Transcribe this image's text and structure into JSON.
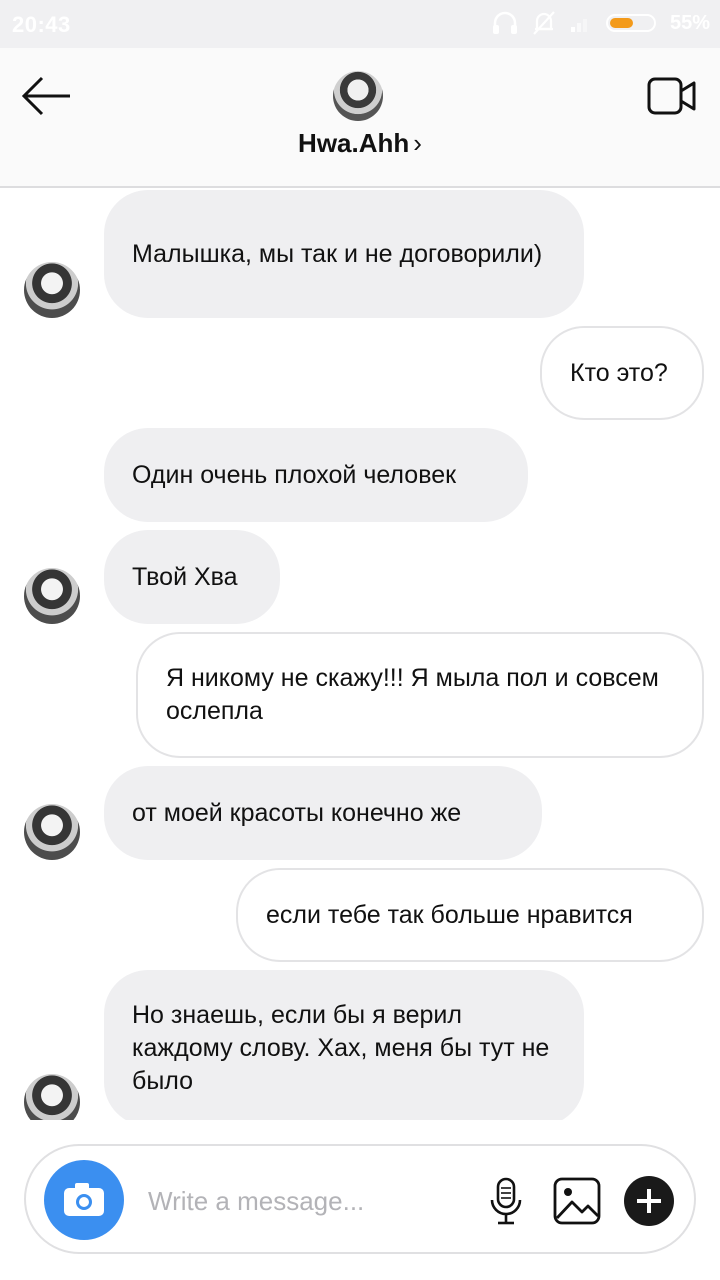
{
  "status_bar": {
    "time": "20:43",
    "battery_percent": "55%",
    "battery_level": 0.55
  },
  "header": {
    "title": "Hwa.Ahh",
    "title_chevron": "›"
  },
  "messages": [
    {
      "from": "them",
      "text": "Малышка, мы так и не договорили)",
      "avatar": true
    },
    {
      "from": "me",
      "text": "Кто это?"
    },
    {
      "from": "them",
      "text": "Один очень плохой человек",
      "avatar": false
    },
    {
      "from": "them",
      "text": "Твой Хва",
      "avatar": true
    },
    {
      "from": "me",
      "text": "Я никому не скажу!!! Я мыла пол и совсем ослепла"
    },
    {
      "from": "them",
      "text": "от моей красоты конечно же",
      "avatar": true
    },
    {
      "from": "me",
      "text": "если тебе так больше нравится"
    },
    {
      "from": "them",
      "text": "Но знаешь, если бы я верил каждому слову. Хах, меня бы тут не было",
      "avatar": true
    }
  ],
  "composer": {
    "placeholder": "Write a message..."
  },
  "icons": {
    "back": "arrow-left-icon",
    "video": "video-camera-icon",
    "camera": "camera-icon",
    "mic": "microphone-icon",
    "gallery": "image-icon",
    "plus": "plus-icon"
  },
  "colors": {
    "accent": "#3b8ff0",
    "incoming_bubble": "#efeff1",
    "battery": "#f39a1a"
  }
}
